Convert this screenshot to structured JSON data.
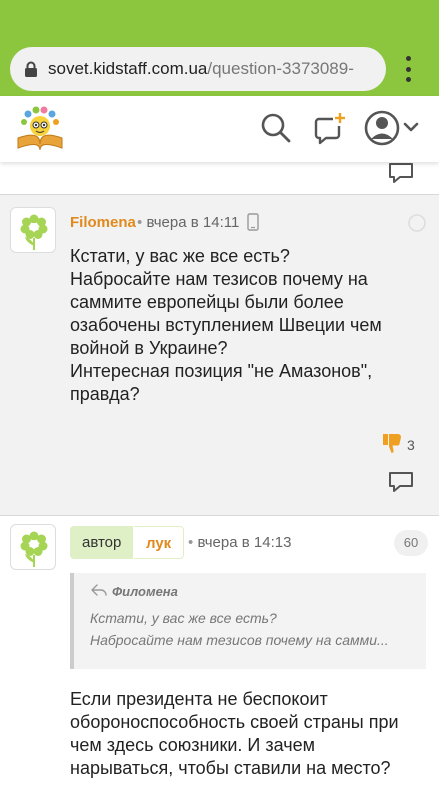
{
  "browser": {
    "url_host": "sovet.kidstaff.com.ua",
    "url_path": "/question-3373089-"
  },
  "colors": {
    "brand_green": "#8cc63f",
    "author_orange": "#e08a1e",
    "author_badge_bg": "#dff0c6",
    "dislike_thumb": "#f0a020"
  },
  "header": {
    "icons": [
      "logo-icon",
      "search-icon",
      "add-question-icon",
      "user-avatar-icon",
      "chevron-down-icon"
    ]
  },
  "comments": [
    {
      "author": "Filomena",
      "time": "вчера в 14:11",
      "device": "phone-icon",
      "lines": [
        "Кстати, у вас же все есть?",
        "Набросайте нам тезисов почему на",
        "саммите европейцы были более",
        "озабочены вступлением Швеции чем",
        "войной в Украине?",
        "Интересная позиция \"не Амазонов\",",
        "правда?"
      ],
      "dislikes": "3"
    },
    {
      "author_badge": "автор",
      "author": "лук",
      "time": "вчера в 14:13",
      "number": "60",
      "quote": {
        "author": "Филомена",
        "lines": [
          "Кстати, у вас же все есть?",
          "Набросайте нам тезисов почему на самми..."
        ]
      },
      "lines": [
        "Если президента не беспокоит",
        "обороноспособность своей страны при",
        "чем здесь союзники. И зачем",
        "нарываться, чтобы ставили на место?"
      ]
    }
  ]
}
